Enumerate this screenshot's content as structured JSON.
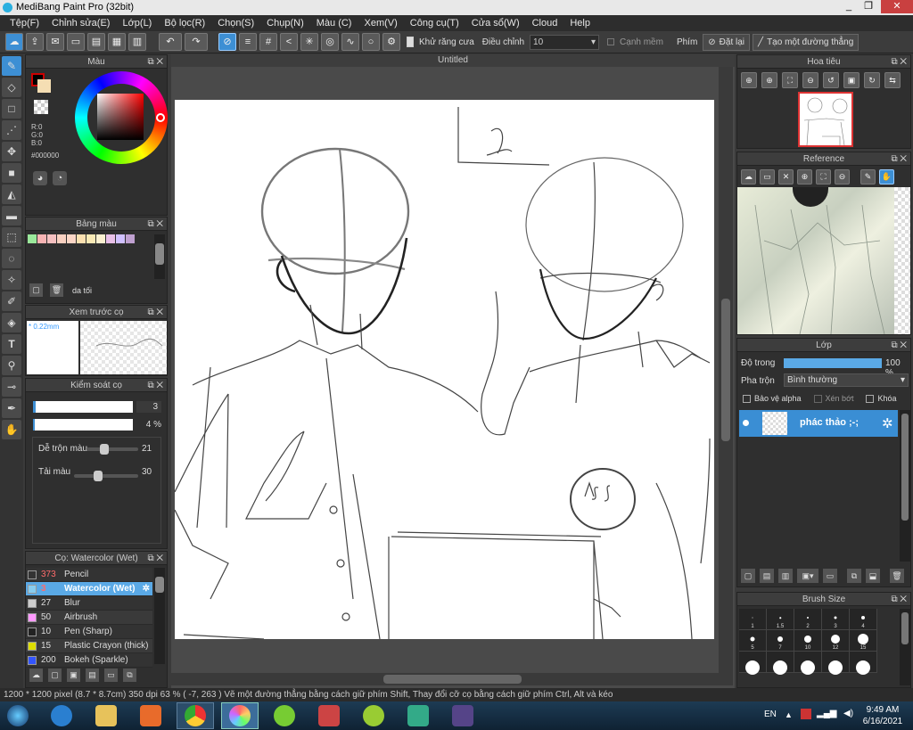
{
  "app": {
    "title": "MediBang Paint Pro (32bit)"
  },
  "window_buttons": [
    "_",
    "❐",
    "✕"
  ],
  "menu": [
    "Tệp(F)",
    "Chỉnh sửa(E)",
    "Lớp(L)",
    "Bộ lọc(R)",
    "Chọn(S)",
    "Chụp(N)",
    "Màu (C)",
    "Xem(V)",
    "Công cụ(T)",
    "Cửa sổ(W)",
    "Cloud",
    "Help"
  ],
  "toolbar": {
    "antialias_label": "Khử răng cưa",
    "correction_label": "Điều chỉnh",
    "correction_value": "10",
    "soft_edge_label": "Cạnh mềm",
    "key_label": "Phím",
    "reset_label": "Đặt lại",
    "line_label": "Tạo một đường thẳng"
  },
  "color_panel": {
    "title": "Màu",
    "r": "R:0",
    "g": "G:0",
    "b": "B:0",
    "hex": "#000000",
    "fg": "#000000",
    "bg": "#f5deb3"
  },
  "palette_panel": {
    "title": "Bảng màu",
    "name": "da tối",
    "swatches": [
      "#9be89b",
      "#f7b3b3",
      "#f5c0c0",
      "#f9d0c0",
      "#fbd5c5",
      "#fbe0b0",
      "#f9e9b5",
      "#fbf0d0",
      "#e8c0e8",
      "#d0c0ff",
      "#bfa0d0"
    ]
  },
  "preview_panel": {
    "title": "Xem trước cọ",
    "size": "* 0.22mm"
  },
  "brush_control": {
    "title": "Kiểm soát cọ",
    "size_value": "3",
    "opacity_value": "4 %",
    "blend_label": "Dễ trộn màu",
    "blend_value": "21",
    "load_label": "Tải màu",
    "load_value": "30",
    "blend_level": 0.25,
    "load_level": 0.3
  },
  "brush_list": {
    "title": "Cọ: Watercolor (Wet)",
    "items": [
      {
        "size": "373",
        "name": "Pencil",
        "color": "#333333",
        "selected": false
      },
      {
        "size": "3",
        "name": "Watercolor (Wet)",
        "color": "#88ccee",
        "selected": true
      },
      {
        "size": "27",
        "name": "Blur",
        "color": "#cccccc",
        "selected": false
      },
      {
        "size": "50",
        "name": "Airbrush",
        "color": "#ff99ff",
        "selected": false
      },
      {
        "size": "10",
        "name": "Pen (Sharp)",
        "color": "#222222",
        "selected": false
      },
      {
        "size": "15",
        "name": "Plastic Crayon (thick)",
        "color": "#dddd00",
        "selected": false
      },
      {
        "size": "200",
        "name": "Bokeh (Sparkle)",
        "color": "#3355ff",
        "selected": false
      }
    ]
  },
  "canvas": {
    "tab": "Untitled"
  },
  "navigator": {
    "title": "Hoa tiêu"
  },
  "reference": {
    "title": "Reference"
  },
  "layer_panel": {
    "title": "Lớp",
    "opacity_label": "Độ trong",
    "opacity_value": "100 %",
    "opacity_level": 1.0,
    "blend_label": "Pha trộn",
    "blend_value": "Bình thường",
    "protect_alpha": "Bảo vệ alpha",
    "clip": "Xén bớt",
    "lock": "Khóa",
    "layer_name": "phác thảo ;-;"
  },
  "brush_size": {
    "title": "Brush Size",
    "row1": [
      "1",
      "1.5",
      "2",
      "3",
      "4"
    ],
    "row2": [
      "5",
      "7",
      "10",
      "12",
      "15"
    ]
  },
  "status": {
    "text": "1200 * 1200 pixel   (8.7 * 8.7cm)   350 dpi   63 %   ( -7, 263 )   Vẽ một đường thẳng bằng cách giữ phím Shift, Thay đổi cỡ cọ bằng cách giữ phím Ctrl, Alt và kéo"
  },
  "tray": {
    "lang": "EN",
    "time": "9:49 AM",
    "date": "6/16/2021"
  }
}
